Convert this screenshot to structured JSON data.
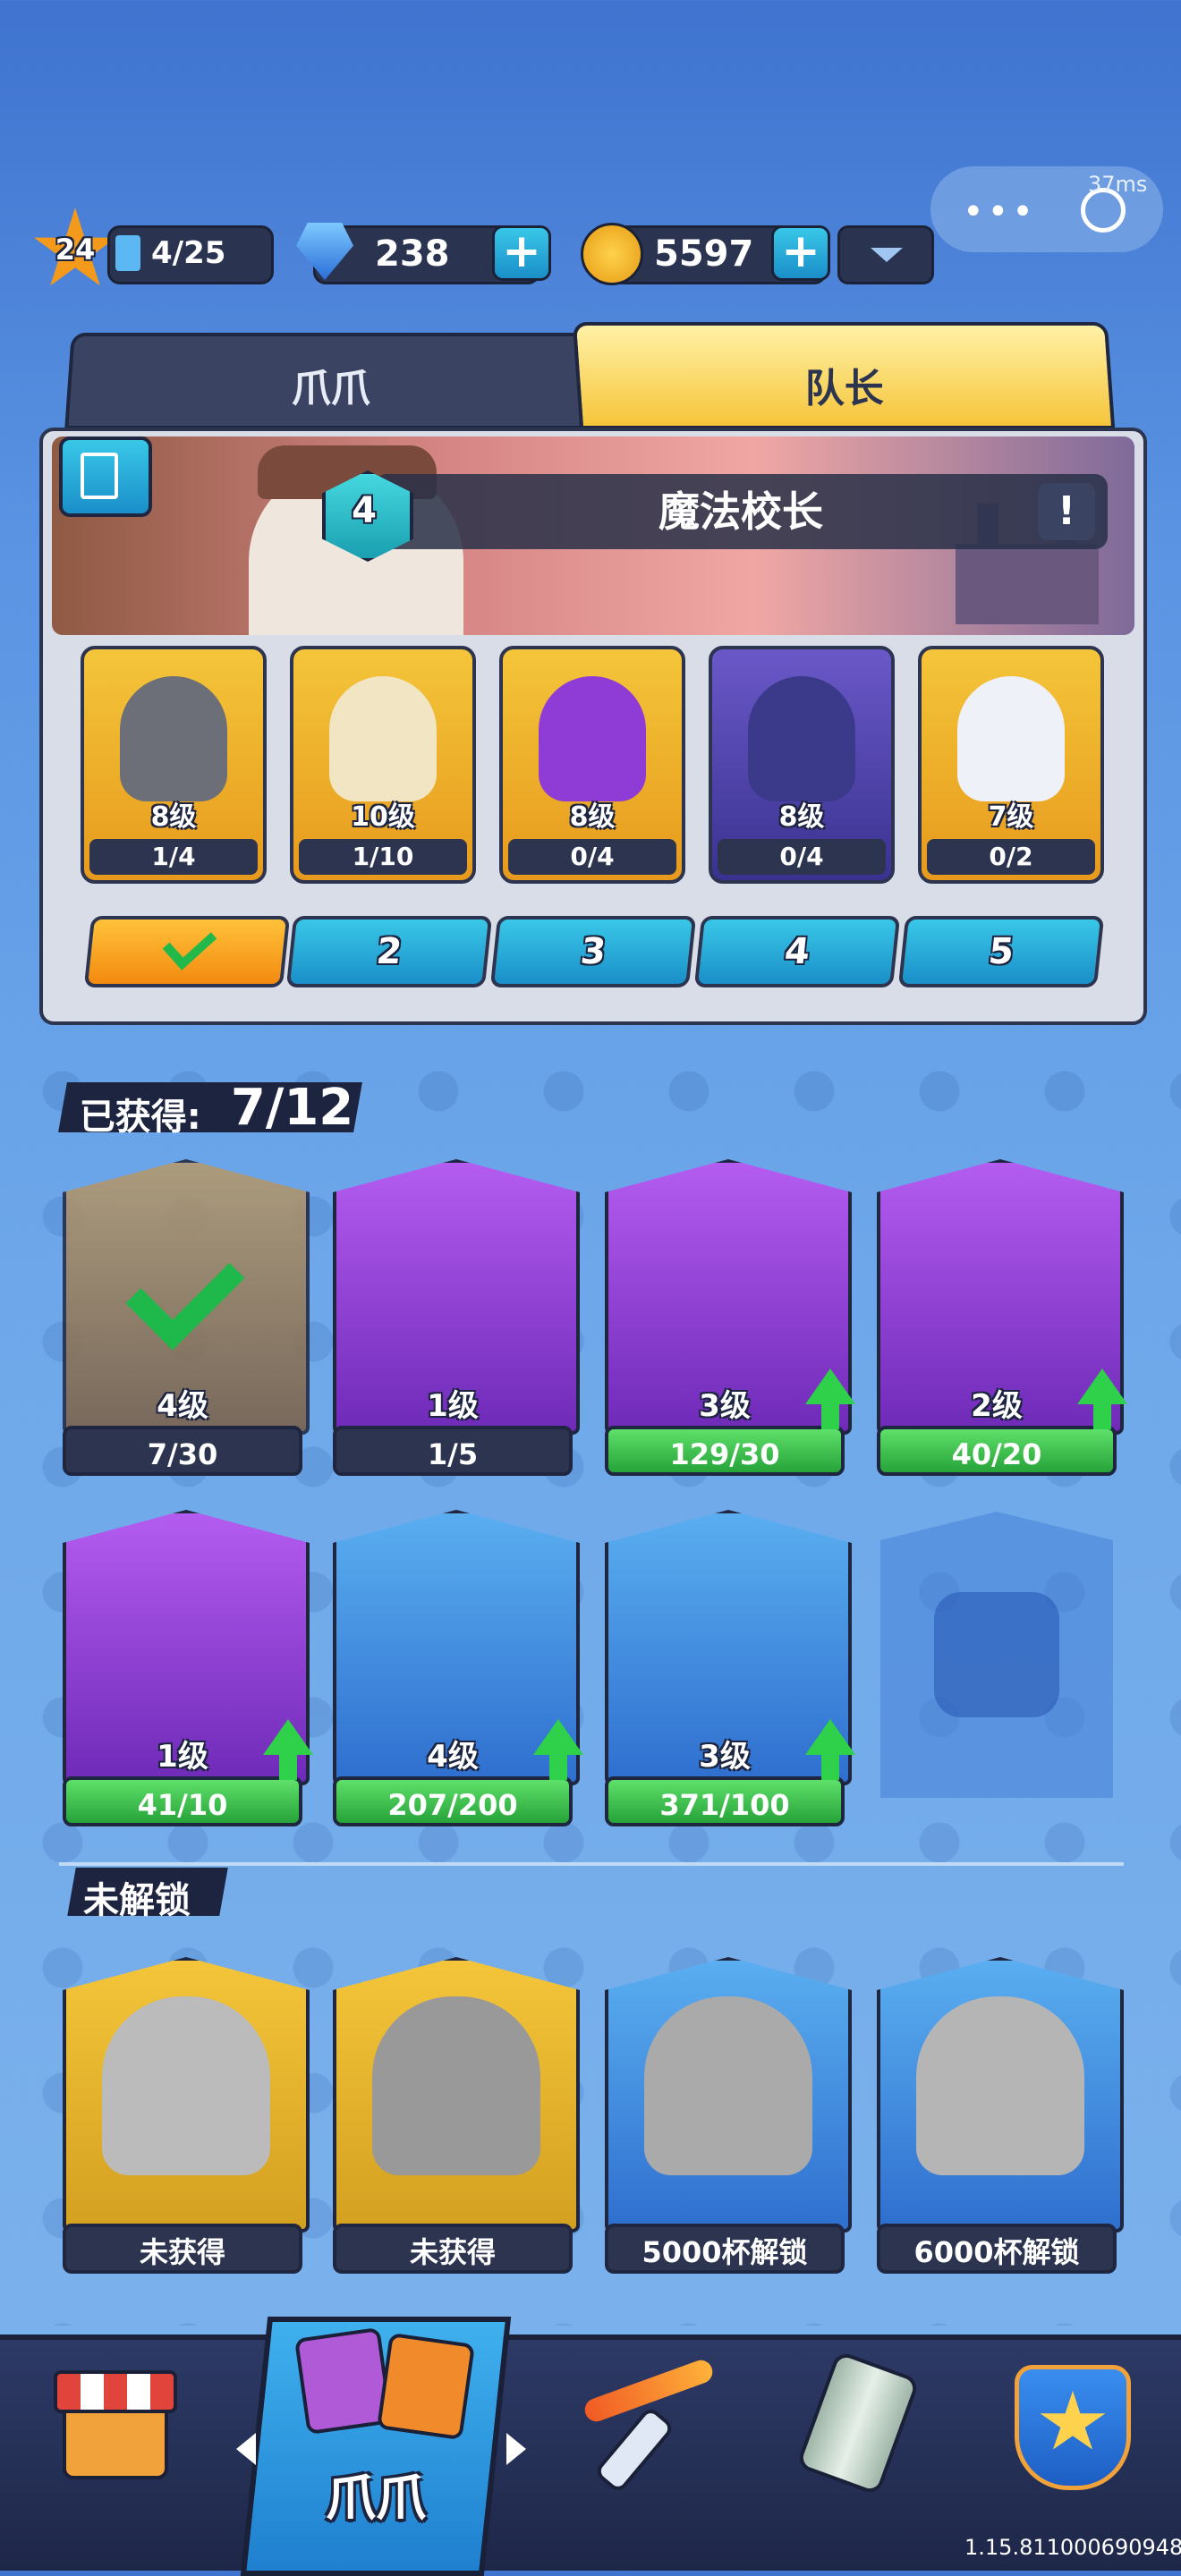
{
  "status": {
    "latency": "37ms",
    "version": "1.15.811000690948"
  },
  "top_bar": {
    "player_level": "24",
    "xp": "4/25",
    "gems": "238",
    "coins": "5597"
  },
  "tabs": [
    {
      "label": "爪爪"
    },
    {
      "label": "队长"
    }
  ],
  "captain": {
    "level": "4",
    "name": "魔法校长",
    "info": "!"
  },
  "team_heroes": [
    {
      "level": "8级",
      "progress": "1/4"
    },
    {
      "level": "10级",
      "progress": "1/10"
    },
    {
      "level": "8级",
      "progress": "0/4"
    },
    {
      "level": "8级",
      "progress": "0/4"
    },
    {
      "level": "7级",
      "progress": "0/2"
    }
  ],
  "team_slots": [
    "",
    "2",
    "3",
    "4",
    "5"
  ],
  "owned": {
    "label": "已获得:",
    "count": "7/12",
    "cards": [
      {
        "level": "4级",
        "progress": "7/30"
      },
      {
        "level": "1级",
        "progress": "1/5"
      },
      {
        "level": "3级",
        "progress": "129/30"
      },
      {
        "level": "2级",
        "progress": "40/20"
      },
      {
        "level": "1级",
        "progress": "41/10"
      },
      {
        "level": "4级",
        "progress": "207/200"
      },
      {
        "level": "3级",
        "progress": "371/100"
      }
    ]
  },
  "locked": {
    "label": "未解锁",
    "cards": [
      {
        "status": "未获得"
      },
      {
        "status": "未获得"
      },
      {
        "status": "5000杯解锁"
      },
      {
        "status": "6000杯解锁"
      }
    ]
  },
  "bottom_nav": {
    "active_label": "爪爪"
  },
  "colors": {
    "accent_blue": "#1a8fc9",
    "gold": "#f4c53a",
    "green": "#27a33a",
    "purple": "#8f3bd6"
  }
}
